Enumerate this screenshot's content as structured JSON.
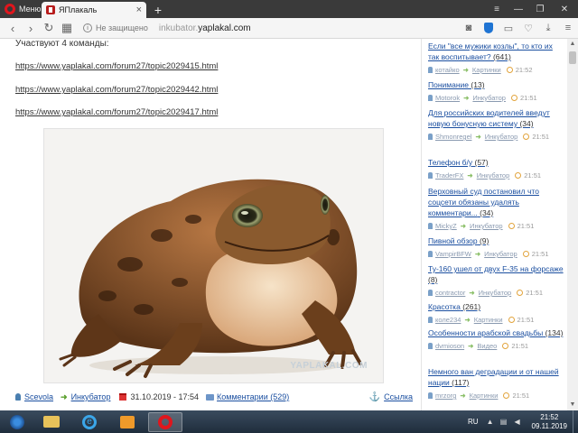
{
  "browser": {
    "menu_label": "Меню",
    "tab_title": "ЯПлакаль",
    "newtab_label": "+",
    "not_secure": "Не защищено",
    "url_sub": "inkubator.",
    "url_domain": "yaplakal.com"
  },
  "post": {
    "intro": "Участвуют 4 команды:",
    "links": [
      "https://www.yaplakal.com/forum27/topic2029415.html",
      "https://www.yaplakal.com/forum27/topic2029442.html",
      "https://www.yaplakal.com/forum27/topic2029417.html"
    ],
    "image_watermark": "YAPLAKAL.COM",
    "footer": {
      "author": "Scevola",
      "section": "Инкубатор",
      "date": "31.10.2019 - 17:54",
      "comments": "Комментарии (529)",
      "share": "Ссылка"
    }
  },
  "sidebar": {
    "items": [
      {
        "title": "Если \"все мужики козлы\", то кто их так воспитывает?",
        "count": "(641)",
        "user": "котайко",
        "section": "Картинки",
        "time": "21:52"
      },
      {
        "title": "Понимание",
        "count": "(13)",
        "user": "Motorok",
        "section": "Инкубатор",
        "time": "21:51"
      },
      {
        "title": "Для российских водителей введут новую бонусную систему",
        "count": "(34)",
        "user": "Shmonregel",
        "section": "Инкубатор",
        "time": "21:51"
      },
      {
        "title": "Телефон б/у",
        "count": "(57)",
        "user": "TraderFX",
        "section": "Инкубатор",
        "time": "21:51"
      },
      {
        "title": "Верховный суд постановил что соцсети обязаны удалять комментари...",
        "count": "(34)",
        "user": "MickyZ",
        "section": "Инкубатор",
        "time": "21:51"
      },
      {
        "title": "Пивной обзор",
        "count": "(9)",
        "user": "VampirBFW",
        "section": "Инкубатор",
        "time": "21:51"
      },
      {
        "title": "Ту-160 ушел от двух F-35 на форсаже",
        "count": "(8)",
        "user": "contractor",
        "section": "Инкубатор",
        "time": "21:51"
      },
      {
        "title": "Красотка",
        "count": "(261)",
        "user": "коле234",
        "section": "Картинки",
        "time": "21:51"
      },
      {
        "title": "Особенности арабской свадьбы",
        "count": "(134)",
        "user": "dvmioson",
        "section": "Видео",
        "time": "21:51"
      },
      {
        "title": "Немного ван деградации и от нашей нации",
        "count": "(117)",
        "user": "mrzorg",
        "section": "Картинки",
        "time": "21:51"
      }
    ]
  },
  "taskbar": {
    "lang": "RU",
    "time": "21:52",
    "date": "09.11.2019"
  },
  "colors": {
    "link": "#1b4fa0",
    "opera_red": "#e0161d",
    "tabbar": "#3a3a3a"
  }
}
